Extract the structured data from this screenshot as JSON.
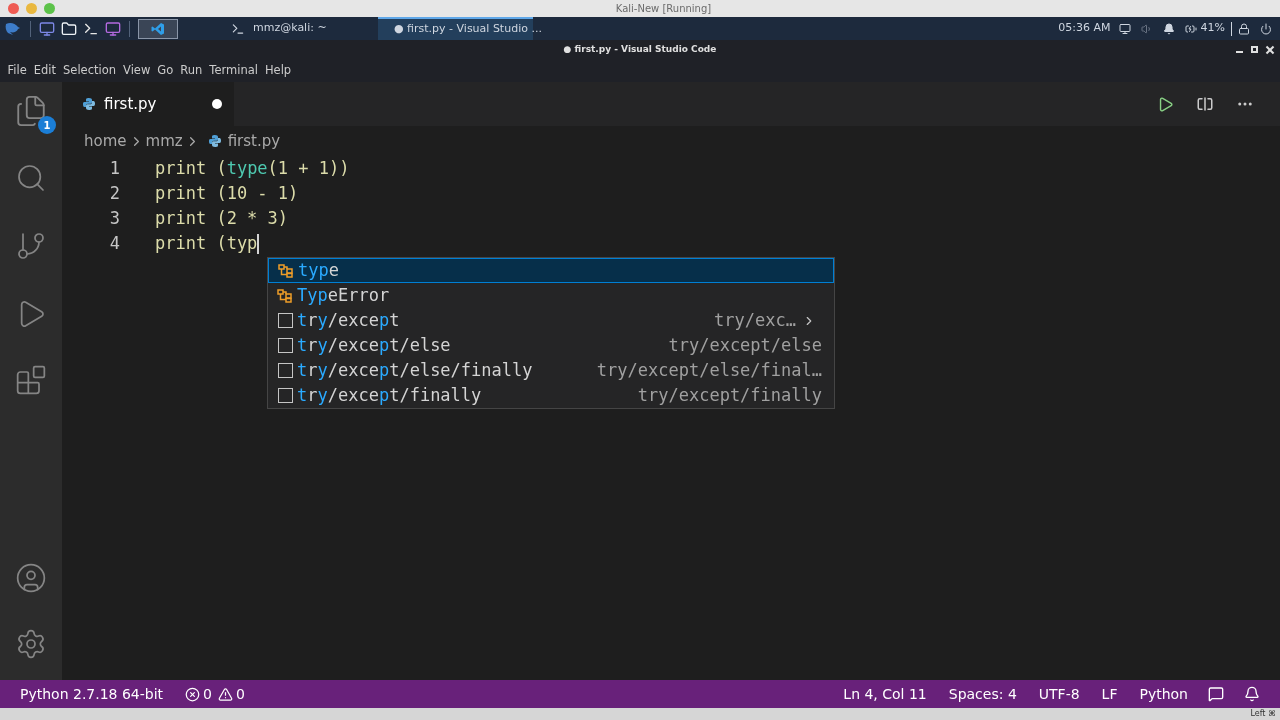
{
  "host_window": {
    "title": "Kali-New [Running]"
  },
  "taskbar": {
    "tasks": [
      {
        "label": "mmz@kali: ~",
        "kind": "terminal",
        "selected": false
      },
      {
        "label": "● first.py - Visual Studio ...",
        "kind": "vscode",
        "selected": true
      }
    ],
    "clock": "05:36 AM",
    "battery": "41%"
  },
  "window": {
    "title": "● first.py - Visual Studio Code"
  },
  "menu": [
    "File",
    "Edit",
    "Selection",
    "View",
    "Go",
    "Run",
    "Terminal",
    "Help"
  ],
  "activity_bar": {
    "explorer_badge": "1"
  },
  "tabs": [
    {
      "label": "first.py",
      "selected": true,
      "modified": true
    }
  ],
  "breadcrumb": [
    "home",
    "mmz",
    "first.py"
  ],
  "editor": {
    "lines": [
      {
        "number": "1",
        "tokens": [
          {
            "text": "print (",
            "kind": "plain"
          },
          {
            "text": "type",
            "kind": "builtin"
          },
          {
            "text": "(1 + 1))",
            "kind": "plain"
          }
        ]
      },
      {
        "number": "2",
        "tokens": [
          {
            "text": "print (10 - 1)",
            "kind": "plain"
          }
        ]
      },
      {
        "number": "3",
        "tokens": [
          {
            "text": "print (2 * 3)",
            "kind": "plain"
          }
        ]
      },
      {
        "number": "4",
        "tokens": [
          {
            "text": "print (typ",
            "kind": "plain"
          }
        ],
        "cursor": true
      }
    ]
  },
  "suggestions": [
    {
      "kind": "class",
      "selected": true,
      "parts": [
        {
          "text": "typ",
          "match": true
        },
        {
          "text": "e",
          "match": false
        }
      ]
    },
    {
      "kind": "class",
      "selected": false,
      "parts": [
        {
          "text": "Typ",
          "match": true
        },
        {
          "text": "eError",
          "match": false
        }
      ]
    },
    {
      "kind": "snippet",
      "selected": false,
      "parts": [
        {
          "text": "t",
          "match": true
        },
        {
          "text": "r",
          "match": false
        },
        {
          "text": "y",
          "match": true
        },
        {
          "text": "/exce",
          "match": false
        },
        {
          "text": "p",
          "match": true
        },
        {
          "text": "t",
          "match": false
        }
      ],
      "detail": "try/exc…",
      "expandable": true
    },
    {
      "kind": "snippet",
      "selected": false,
      "parts": [
        {
          "text": "t",
          "match": true
        },
        {
          "text": "r",
          "match": false
        },
        {
          "text": "y",
          "match": true
        },
        {
          "text": "/exce",
          "match": false
        },
        {
          "text": "p",
          "match": true
        },
        {
          "text": "t/else",
          "match": false
        }
      ],
      "detail": "try/except/else",
      "expandable": false
    },
    {
      "kind": "snippet",
      "selected": false,
      "parts": [
        {
          "text": "t",
          "match": true
        },
        {
          "text": "r",
          "match": false
        },
        {
          "text": "y",
          "match": true
        },
        {
          "text": "/exce",
          "match": false
        },
        {
          "text": "p",
          "match": true
        },
        {
          "text": "t/else/finally",
          "match": false
        }
      ],
      "detail": "try/except/else/final…",
      "expandable": false
    },
    {
      "kind": "snippet",
      "selected": false,
      "parts": [
        {
          "text": "t",
          "match": true
        },
        {
          "text": "r",
          "match": false
        },
        {
          "text": "y",
          "match": true
        },
        {
          "text": "/exce",
          "match": false
        },
        {
          "text": "p",
          "match": true
        },
        {
          "text": "t/finally",
          "match": false
        }
      ],
      "detail": "try/except/finally",
      "expandable": false
    }
  ],
  "status_bar": {
    "interpreter": "Python 2.7.18 64-bit",
    "errors": "0",
    "warnings": "0",
    "position": "Ln 4, Col 11",
    "indent": "Spaces: 4",
    "encoding": "UTF-8",
    "eol": "LF",
    "language": "Python"
  },
  "host_status": {
    "host_key": "Left ⌘"
  }
}
